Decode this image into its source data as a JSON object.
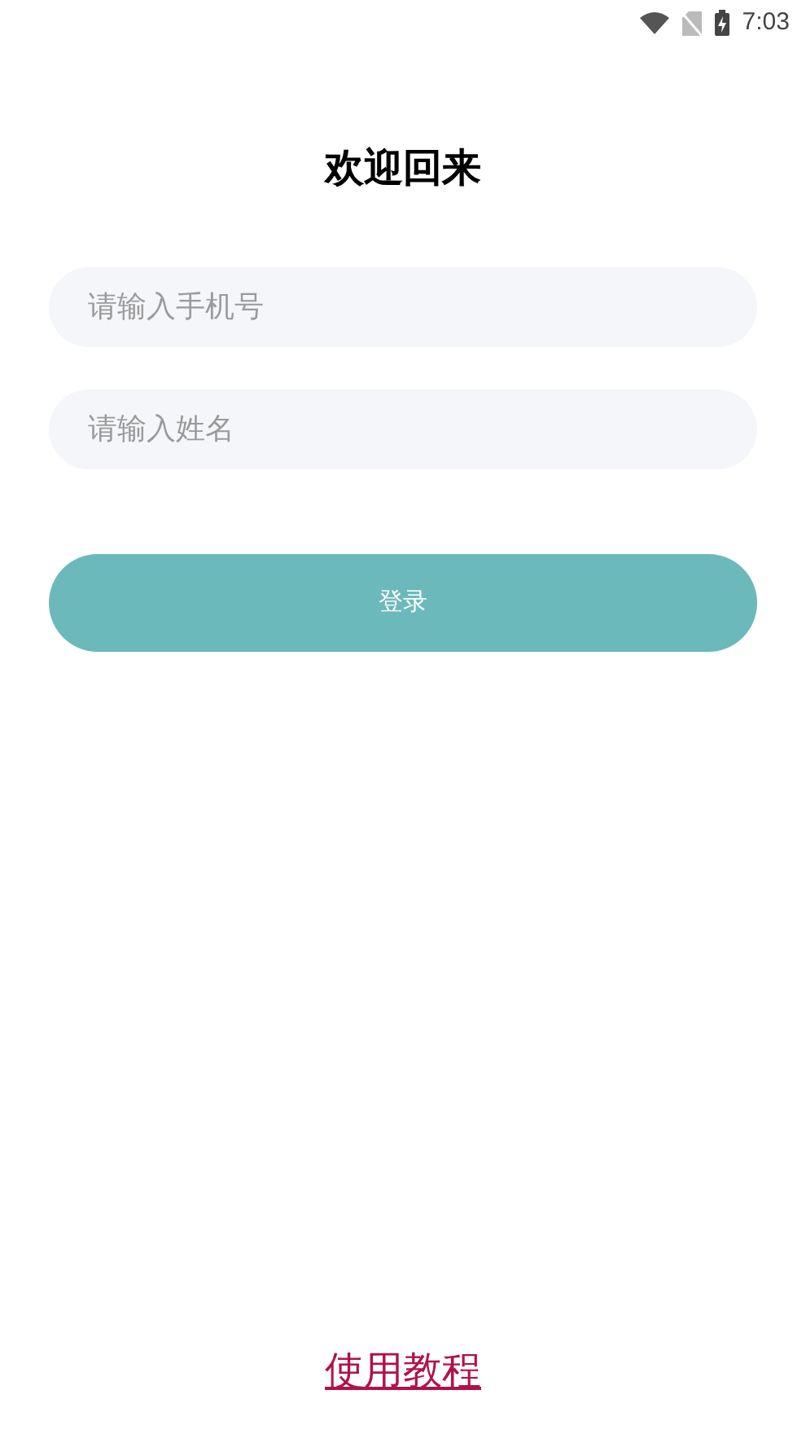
{
  "status_bar": {
    "time": "7:03"
  },
  "title": "欢迎回来",
  "fields": [
    {
      "placeholder": "请输入手机号"
    },
    {
      "placeholder": "请输入姓名"
    }
  ],
  "login_button": "登录",
  "tutorial_link": "使用教程"
}
